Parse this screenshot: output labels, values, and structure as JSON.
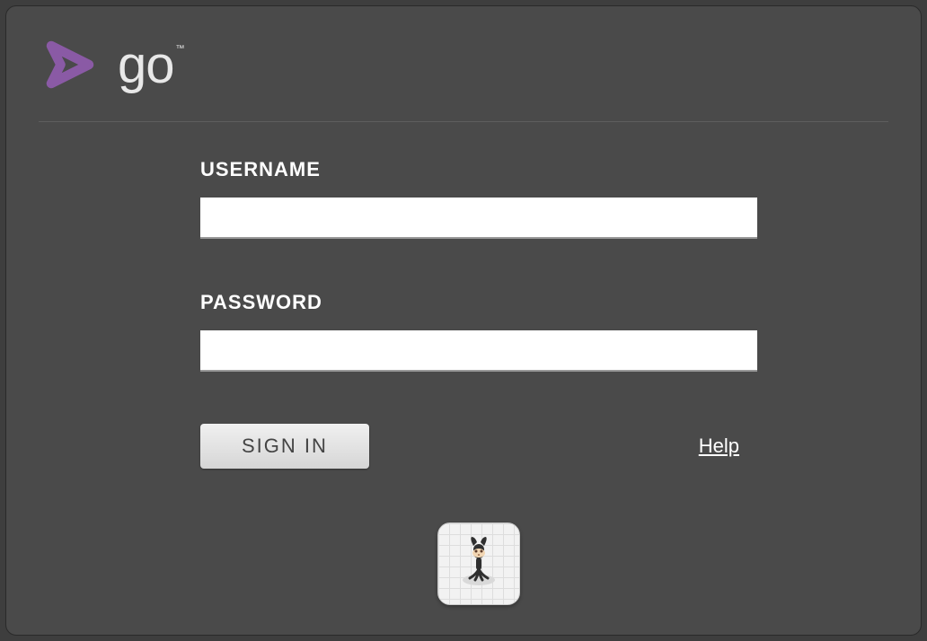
{
  "brand": {
    "name": "go",
    "tm": "™",
    "accent": "#8a5aa5"
  },
  "form": {
    "username_label": "USERNAME",
    "username_value": "",
    "password_label": "PASSWORD",
    "password_value": "",
    "signin_label": "SIGN IN",
    "help_label": "Help"
  },
  "oauth": {
    "github_name": "github-login"
  }
}
